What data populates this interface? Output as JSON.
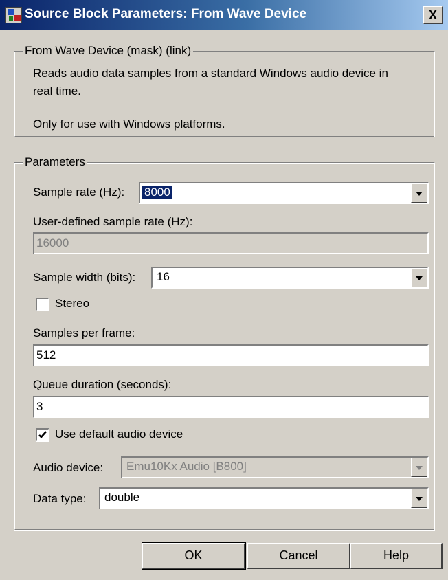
{
  "window": {
    "title": "Source Block Parameters: From Wave Device",
    "close_label": "X"
  },
  "description_group": {
    "title": "From Wave Device (mask) (link)",
    "line1": "Reads audio data samples from a standard Windows audio device in",
    "line2": "real time.",
    "line3": "Only for use with Windows platforms."
  },
  "parameters": {
    "title": "Parameters",
    "sample_rate": {
      "label": "Sample rate (Hz):",
      "value": "8000"
    },
    "user_rate": {
      "label": "User-defined sample rate (Hz):",
      "value": "16000"
    },
    "sample_width": {
      "label": "Sample width (bits):",
      "value": "16"
    },
    "stereo": {
      "label": "Stereo",
      "checked": false
    },
    "samples_per_frame": {
      "label": "Samples per frame:",
      "value": "512"
    },
    "queue_duration": {
      "label": "Queue duration (seconds):",
      "value": "3"
    },
    "use_default_device": {
      "label": "Use default audio device",
      "checked": true
    },
    "audio_device": {
      "label": "Audio device:",
      "value": "Emu10Kx Audio [B800]"
    },
    "data_type": {
      "label": "Data type:",
      "value": "double"
    }
  },
  "buttons": {
    "ok": "OK",
    "cancel": "Cancel",
    "help": "Help"
  },
  "icons": {
    "window_icon": "simulink-block-icon",
    "close": "close-icon",
    "dropdown": "chevron-down-icon",
    "check": "checkmark-icon"
  }
}
